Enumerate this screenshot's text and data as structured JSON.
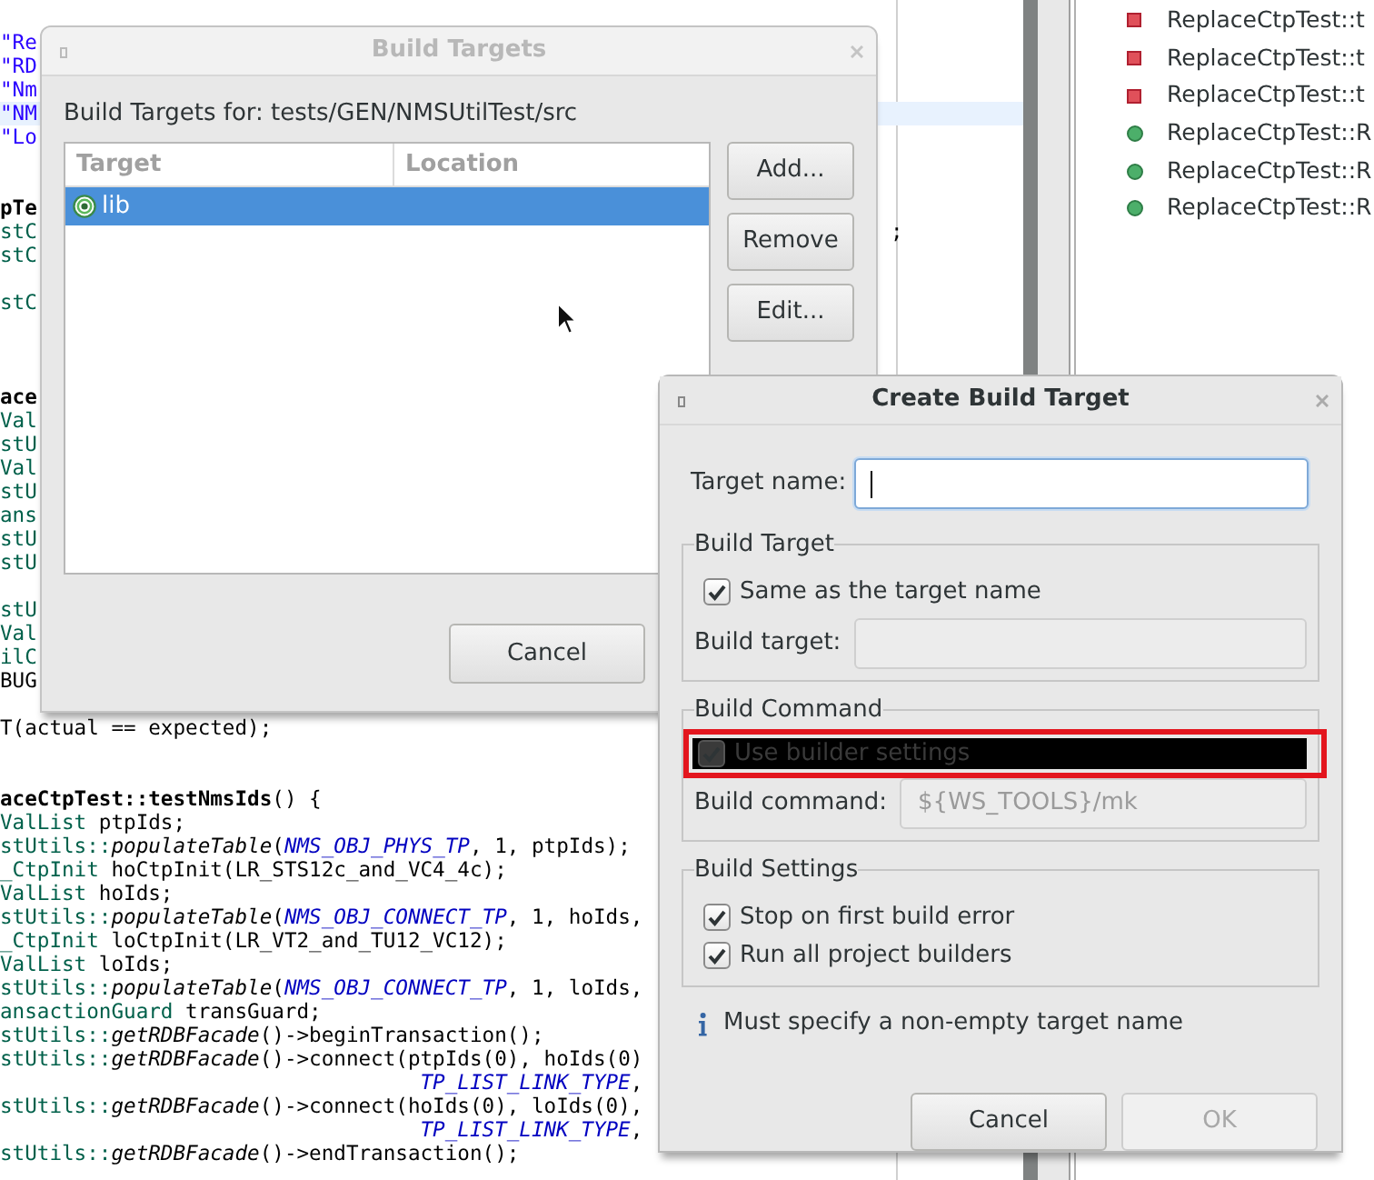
{
  "editor": {
    "lines": [
      {
        "current": false,
        "segments": [
          {
            "kind": "string",
            "text": "\"Re"
          }
        ]
      },
      {
        "current": false,
        "segments": [
          {
            "kind": "string",
            "text": "\"RD"
          }
        ]
      },
      {
        "current": false,
        "segments": [
          {
            "kind": "string",
            "text": "\"Nm"
          }
        ]
      },
      {
        "current": true,
        "segments": [
          {
            "kind": "string",
            "text": "\"NM"
          }
        ]
      },
      {
        "current": false,
        "segments": [
          {
            "kind": "string",
            "text": "\"Lo"
          }
        ]
      },
      {
        "current": false
      },
      {
        "current": false
      },
      {
        "current": false,
        "segments": [
          {
            "kind": "bold",
            "text": "pTe"
          }
        ]
      },
      {
        "current": false,
        "segments": [
          {
            "kind": "type",
            "text": "stC"
          }
        ],
        "tail": ";"
      },
      {
        "current": false,
        "segments": [
          {
            "kind": "type",
            "text": "stC"
          }
        ]
      },
      {
        "current": false
      },
      {
        "current": false,
        "segments": [
          {
            "kind": "type",
            "text": "stC"
          }
        ]
      },
      {
        "current": false
      },
      {
        "current": false
      },
      {
        "current": false
      },
      {
        "current": false,
        "segments": [
          {
            "kind": "bold",
            "text": "ace"
          }
        ]
      },
      {
        "current": false,
        "segments": [
          {
            "kind": "type",
            "text": "Val"
          }
        ]
      },
      {
        "current": false,
        "segments": [
          {
            "kind": "type",
            "text": "stU"
          }
        ]
      },
      {
        "current": false,
        "segments": [
          {
            "kind": "type",
            "text": "Val"
          }
        ]
      },
      {
        "current": false,
        "segments": [
          {
            "kind": "type",
            "text": "stU"
          }
        ]
      },
      {
        "current": false,
        "segments": [
          {
            "kind": "type",
            "text": "ans"
          }
        ]
      },
      {
        "current": false,
        "segments": [
          {
            "kind": "type",
            "text": "stU"
          }
        ]
      },
      {
        "current": false,
        "segments": [
          {
            "kind": "type",
            "text": "stU"
          }
        ]
      },
      {
        "current": false
      },
      {
        "current": false,
        "segments": [
          {
            "kind": "type",
            "text": "stU"
          }
        ]
      },
      {
        "current": false,
        "segments": [
          {
            "kind": "type",
            "text": "Val"
          }
        ]
      },
      {
        "current": false,
        "segments": [
          {
            "kind": "type",
            "text": "ilC"
          }
        ]
      },
      {
        "current": false,
        "segments": [
          {
            "kind": "plain",
            "text": "BUG"
          }
        ]
      },
      {
        "current": false
      },
      {
        "current": false,
        "segments": [
          {
            "kind": "plain",
            "text": "T(actual == expected);"
          }
        ]
      },
      {
        "current": false
      },
      {
        "current": false
      },
      {
        "current": false,
        "segments": [
          {
            "kind": "bold",
            "text": "aceCtpTest::testNmsIds"
          },
          {
            "kind": "plain",
            "text": "() {"
          }
        ]
      },
      {
        "current": false,
        "segments": [
          {
            "kind": "type",
            "text": "ValList"
          },
          {
            "kind": "plain",
            "text": " ptpIds;"
          }
        ]
      },
      {
        "current": false,
        "segments": [
          {
            "kind": "type",
            "text": "stUtils::"
          },
          {
            "kind": "call",
            "text": "populateTable"
          },
          {
            "kind": "plain",
            "text": "("
          },
          {
            "kind": "constant",
            "text": "NMS_OBJ_PHYS_TP"
          },
          {
            "kind": "plain",
            "text": ", 1, ptpIds);"
          }
        ]
      },
      {
        "current": false,
        "segments": [
          {
            "kind": "type",
            "text": "_CtpInit"
          },
          {
            "kind": "plain",
            "text": " hoCtpInit(LR_STS12c_and_VC4_4c);"
          }
        ]
      },
      {
        "current": false,
        "segments": [
          {
            "kind": "type",
            "text": "ValList"
          },
          {
            "kind": "plain",
            "text": " hoIds;"
          }
        ]
      },
      {
        "current": false,
        "segments": [
          {
            "kind": "type",
            "text": "stUtils::"
          },
          {
            "kind": "call",
            "text": "populateTable"
          },
          {
            "kind": "plain",
            "text": "("
          },
          {
            "kind": "constant",
            "text": "NMS_OBJ_CONNECT_TP"
          },
          {
            "kind": "plain",
            "text": ", 1, hoIds,"
          }
        ]
      },
      {
        "current": false,
        "segments": [
          {
            "kind": "type",
            "text": "_CtpInit"
          },
          {
            "kind": "plain",
            "text": " loCtpInit(LR_VT2_and_TU12_VC12);"
          }
        ]
      },
      {
        "current": false,
        "segments": [
          {
            "kind": "type",
            "text": "ValList"
          },
          {
            "kind": "plain",
            "text": " loIds;"
          }
        ]
      },
      {
        "current": false,
        "segments": [
          {
            "kind": "type",
            "text": "stUtils::"
          },
          {
            "kind": "call",
            "text": "populateTable"
          },
          {
            "kind": "plain",
            "text": "("
          },
          {
            "kind": "constant",
            "text": "NMS_OBJ_CONNECT_TP"
          },
          {
            "kind": "plain",
            "text": ", 1, loIds,"
          }
        ]
      },
      {
        "current": false,
        "segments": [
          {
            "kind": "type",
            "text": "ansactionGuard"
          },
          {
            "kind": "plain",
            "text": " transGuard;"
          }
        ]
      },
      {
        "current": false,
        "segments": [
          {
            "kind": "type",
            "text": "stUtils::"
          },
          {
            "kind": "call",
            "text": "getRDBFacade"
          },
          {
            "kind": "plain",
            "text": "()->beginTransaction();"
          }
        ]
      },
      {
        "current": false,
        "segments": [
          {
            "kind": "type",
            "text": "stUtils::"
          },
          {
            "kind": "call",
            "text": "getRDBFacade"
          },
          {
            "kind": "plain",
            "text": "()->connect(ptpIds(0), hoIds(0)"
          }
        ]
      },
      {
        "current": false,
        "segments": [
          {
            "kind": "constant",
            "text": "                                  TP_LIST_LINK_TYPE"
          },
          {
            "kind": "plain",
            "text": ","
          }
        ]
      },
      {
        "current": false,
        "segments": [
          {
            "kind": "type",
            "text": "stUtils::"
          },
          {
            "kind": "call",
            "text": "getRDBFacade"
          },
          {
            "kind": "plain",
            "text": "()->connect(hoIds(0), loIds(0),"
          }
        ]
      },
      {
        "current": false,
        "segments": [
          {
            "kind": "constant",
            "text": "                                  TP_LIST_LINK_TYPE"
          },
          {
            "kind": "plain",
            "text": ","
          }
        ]
      },
      {
        "current": false,
        "segments": [
          {
            "kind": "type",
            "text": "stUtils::"
          },
          {
            "kind": "call",
            "text": "getRDBFacade"
          },
          {
            "kind": "plain",
            "text": "()->endTransaction();"
          }
        ]
      }
    ]
  },
  "test_results": {
    "items": [
      {
        "label": "ReplaceCtpTest::t",
        "kind": "failed"
      },
      {
        "label": "ReplaceCtpTest::t",
        "kind": "failed"
      },
      {
        "label": "ReplaceCtpTest::t",
        "kind": "failed"
      },
      {
        "label": "ReplaceCtpTest::R",
        "kind": "passed"
      },
      {
        "label": "ReplaceCtpTest::R",
        "kind": "passed"
      },
      {
        "label": "ReplaceCtpTest::R",
        "kind": "passed"
      }
    ]
  },
  "build_targets_dialog": {
    "title": "Build Targets",
    "active": false,
    "heading": "Build Targets for: tests/GEN/NMSUtilTest/src",
    "columns": [
      "Target",
      "Location"
    ],
    "rows": [
      {
        "target": "lib",
        "selected": true
      }
    ],
    "side_buttons": [
      "Add...",
      "Remove",
      "Edit..."
    ],
    "buttons": [
      "Cancel"
    ]
  },
  "create_dialog": {
    "title": "Create Build Target",
    "active": true,
    "target_name": {
      "label": "Target name:",
      "focused": true
    },
    "groups": [
      {
        "legend": "Build Target",
        "items": [
          {
            "kind": "checkbox",
            "label": "Same as the target name",
            "checked": true,
            "highlighted": false
          },
          {
            "kind": "field",
            "label": "Build target:",
            "disabled": true
          }
        ]
      },
      {
        "legend": "Build Command",
        "items": [
          {
            "kind": "checkbox",
            "label": "Use builder settings",
            "checked": true,
            "highlighted": true
          },
          {
            "kind": "field",
            "label": "Build command:",
            "value": "${WS_TOOLS}/mk",
            "disabled": true
          }
        ]
      },
      {
        "legend": "Build Settings",
        "items": [
          {
            "kind": "checkbox",
            "label": "Stop on first build error",
            "checked": true,
            "highlighted": false
          },
          {
            "kind": "checkbox",
            "label": "Run all project builders",
            "checked": true,
            "highlighted": false
          }
        ]
      }
    ],
    "message": "Must specify a non-empty target name",
    "buttons": [
      {
        "label": "Cancel",
        "disabled": false
      },
      {
        "label": "OK",
        "disabled": true
      }
    ]
  }
}
